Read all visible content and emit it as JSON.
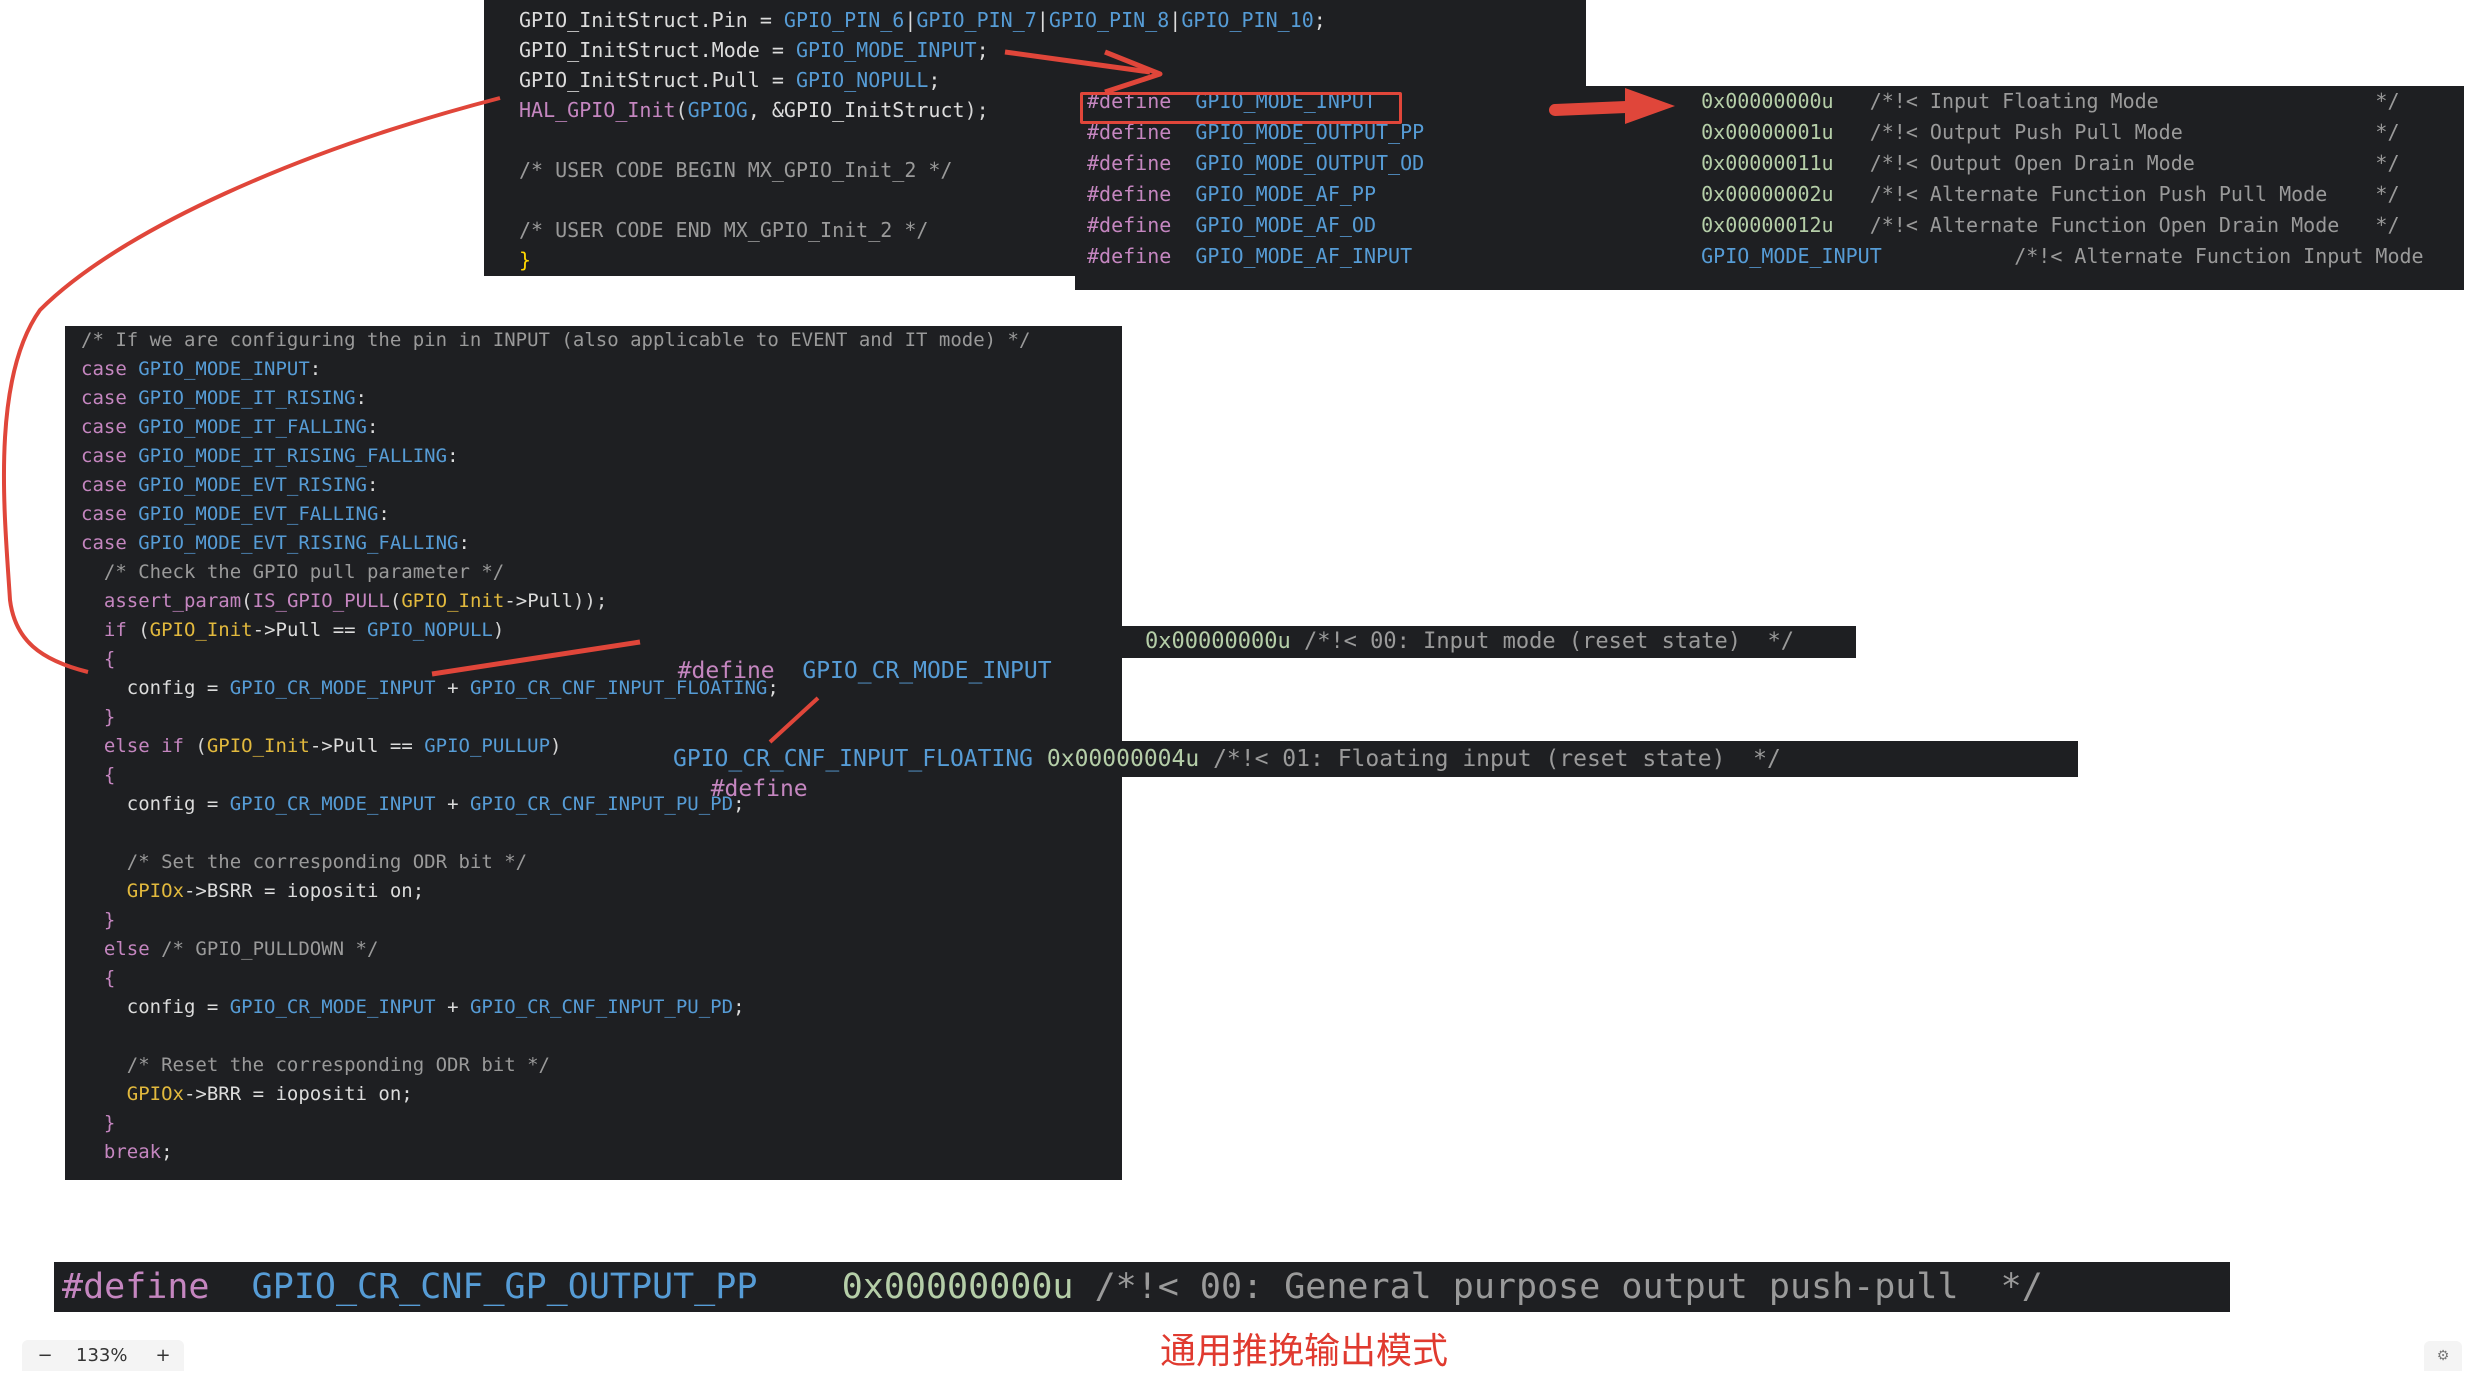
{
  "panels": {
    "init_snippet": [
      [
        [
          "GPIO_InitStruct.Pin = ",
          "plain"
        ],
        [
          "GPIO_PIN_6",
          "blue"
        ],
        [
          "|",
          "plain"
        ],
        [
          "GPIO_PIN_7",
          "blue"
        ],
        [
          "|",
          "plain"
        ],
        [
          "GPIO_PIN_8",
          "blue"
        ],
        [
          "|",
          "plain"
        ],
        [
          "GPIO_PIN_10",
          "blue"
        ],
        [
          ";",
          "plain"
        ]
      ],
      [
        [
          "GPIO_InitStruct.Mode = ",
          "plain"
        ],
        [
          "GPIO_MODE_INPUT",
          "blue"
        ],
        [
          ";",
          "plain"
        ]
      ],
      [
        [
          "GPIO_InitStruct.Pull = ",
          "plain"
        ],
        [
          "GPIO_NOPULL",
          "blue"
        ],
        [
          ";",
          "plain"
        ]
      ],
      [
        [
          "HAL_GPIO_Init",
          "pink"
        ],
        [
          "(",
          "punc"
        ],
        [
          "GPIOG",
          "blue"
        ],
        [
          ", &GPIO_InitStruct",
          "plain"
        ],
        [
          ");",
          "punc"
        ]
      ],
      [],
      [
        [
          "/* USER CODE BEGIN MX_GPIO_Init_2 */",
          "comment"
        ]
      ],
      [],
      [
        [
          "/* USER CODE END MX_GPIO_Init_2 */",
          "comment"
        ]
      ],
      [
        [
          "}",
          "yellow"
        ]
      ]
    ],
    "mode_defines": [
      [
        [
          "#define",
          "pink"
        ],
        [
          "  ",
          "plain"
        ],
        [
          "GPIO_MODE_INPUT",
          "blue"
        ],
        [
          "                           ",
          "plain"
        ],
        [
          "0x00000000u",
          "num"
        ],
        [
          "   /*!< Input Floating Mode                  */",
          "comment"
        ]
      ],
      [
        [
          "#define",
          "pink"
        ],
        [
          "  ",
          "plain"
        ],
        [
          "GPIO_MODE_OUTPUT_PP",
          "blue"
        ],
        [
          "                       ",
          "plain"
        ],
        [
          "0x00000001u",
          "num"
        ],
        [
          "   /*!< Output Push Pull Mode                */",
          "comment"
        ]
      ],
      [
        [
          "#define",
          "pink"
        ],
        [
          "  ",
          "plain"
        ],
        [
          "GPIO_MODE_OUTPUT_OD",
          "blue"
        ],
        [
          "                       ",
          "plain"
        ],
        [
          "0x00000011u",
          "num"
        ],
        [
          "   /*!< Output Open Drain Mode               */",
          "comment"
        ]
      ],
      [
        [
          "#define",
          "pink"
        ],
        [
          "  ",
          "plain"
        ],
        [
          "GPIO_MODE_AF_PP",
          "blue"
        ],
        [
          "                           ",
          "plain"
        ],
        [
          "0x00000002u",
          "num"
        ],
        [
          "   /*!< Alternate Function Push Pull Mode    */",
          "comment"
        ]
      ],
      [
        [
          "#define",
          "pink"
        ],
        [
          "  ",
          "plain"
        ],
        [
          "GPIO_MODE_AF_OD",
          "blue"
        ],
        [
          "                           ",
          "plain"
        ],
        [
          "0x00000012u",
          "num"
        ],
        [
          "   /*!< Alternate Function Open Drain Mode   */",
          "comment"
        ]
      ],
      [
        [
          "#define",
          "pink"
        ],
        [
          "  ",
          "plain"
        ],
        [
          "GPIO_MODE_AF_INPUT",
          "blue"
        ],
        [
          "                        ",
          "plain"
        ],
        [
          "GPIO_MODE_INPUT",
          "blue"
        ],
        [
          "           /*!< Alternate Function Input Mode",
          "comment"
        ]
      ]
    ],
    "switch_case": [
      [
        [
          "/* If we are configuring the pin in INPUT (also applicable to EVENT and IT mode) */",
          "comment"
        ]
      ],
      [
        [
          "case ",
          "pink"
        ],
        [
          "GPIO_MODE_INPUT",
          "blue"
        ],
        [
          ":",
          "plain"
        ]
      ],
      [
        [
          "case ",
          "pink"
        ],
        [
          "GPIO_MODE_IT_RISING",
          "blue"
        ],
        [
          ":",
          "plain"
        ]
      ],
      [
        [
          "case ",
          "pink"
        ],
        [
          "GPIO_MODE_IT_FALLING",
          "blue"
        ],
        [
          ":",
          "plain"
        ]
      ],
      [
        [
          "case ",
          "pink"
        ],
        [
          "GPIO_MODE_IT_RISING_FALLING",
          "blue"
        ],
        [
          ":",
          "plain"
        ]
      ],
      [
        [
          "case ",
          "pink"
        ],
        [
          "GPIO_MODE_EVT_RISING",
          "blue"
        ],
        [
          ":",
          "plain"
        ]
      ],
      [
        [
          "case ",
          "pink"
        ],
        [
          "GPIO_MODE_EVT_FALLING",
          "blue"
        ],
        [
          ":",
          "plain"
        ]
      ],
      [
        [
          "case ",
          "pink"
        ],
        [
          "GPIO_MODE_EVT_RISING_FALLING",
          "blue"
        ],
        [
          ":",
          "plain"
        ]
      ],
      [
        [
          "  /* Check the GPIO pull parameter */",
          "comment"
        ]
      ],
      [
        [
          "  ",
          "plain"
        ],
        [
          "assert_param",
          "pink"
        ],
        [
          "(",
          "punc"
        ],
        [
          "IS_GPIO_PULL",
          "pink"
        ],
        [
          "(",
          "punc"
        ],
        [
          "GPIO_Init",
          "gold"
        ],
        [
          "->Pull",
          "plain"
        ],
        [
          "));",
          "punc"
        ]
      ],
      [
        [
          "  ",
          "plain"
        ],
        [
          "if ",
          "pink"
        ],
        [
          "(",
          "punc"
        ],
        [
          "GPIO_Init",
          "gold"
        ],
        [
          "->Pull == ",
          "plain"
        ],
        [
          "GPIO_NOPULL",
          "blue"
        ],
        [
          ")",
          "punc"
        ]
      ],
      [
        [
          "  ",
          "plain"
        ],
        [
          "{",
          "pink"
        ]
      ],
      [
        [
          "    config = ",
          "plain"
        ],
        [
          "GPIO_CR_MODE_INPUT",
          "blue"
        ],
        [
          " + ",
          "plain"
        ],
        [
          "GPIO_CR_CNF_INPUT_FLOATING",
          "blue"
        ],
        [
          ";",
          "plain"
        ]
      ],
      [
        [
          "  ",
          "plain"
        ],
        [
          "}",
          "pink"
        ]
      ],
      [
        [
          "  ",
          "plain"
        ],
        [
          "else if ",
          "pink"
        ],
        [
          "(",
          "punc"
        ],
        [
          "GPIO_Init",
          "gold"
        ],
        [
          "->Pull == ",
          "plain"
        ],
        [
          "GPIO_PULLUP",
          "blue"
        ],
        [
          ")",
          "punc"
        ]
      ],
      [
        [
          "  ",
          "plain"
        ],
        [
          "{",
          "pink"
        ]
      ],
      [
        [
          "    config = ",
          "plain"
        ],
        [
          "GPIO_CR_MODE_INPUT",
          "blue"
        ],
        [
          " + ",
          "plain"
        ],
        [
          "GPIO_CR_CNF_INPUT_PU_PD",
          "blue"
        ],
        [
          ";",
          "plain"
        ]
      ],
      [],
      [
        [
          "    /* Set the corresponding ODR bit */",
          "comment"
        ]
      ],
      [
        [
          "    ",
          "plain"
        ],
        [
          "GPIOx",
          "gold"
        ],
        [
          "->BSRR = iopositi on;",
          "plain"
        ]
      ],
      [
        [
          "  ",
          "plain"
        ],
        [
          "}",
          "pink"
        ]
      ],
      [
        [
          "  ",
          "plain"
        ],
        [
          "else ",
          "pink"
        ],
        [
          "/* GPIO_PULLDOWN */",
          "comment"
        ]
      ],
      [
        [
          "  ",
          "plain"
        ],
        [
          "{",
          "pink"
        ]
      ],
      [
        [
          "    config = ",
          "plain"
        ],
        [
          "GPIO_CR_MODE_INPUT",
          "blue"
        ],
        [
          " + ",
          "plain"
        ],
        [
          "GPIO_CR_CNF_INPUT_PU_PD",
          "blue"
        ],
        [
          ";",
          "plain"
        ]
      ],
      [],
      [
        [
          "    /* Reset the corresponding ODR bit */",
          "comment"
        ]
      ],
      [
        [
          "    ",
          "plain"
        ],
        [
          "GPIOx",
          "gold"
        ],
        [
          "->BRR = iopositi on;",
          "plain"
        ]
      ],
      [
        [
          "  ",
          "plain"
        ],
        [
          "}",
          "pink"
        ]
      ],
      [
        [
          "  ",
          "plain"
        ],
        [
          "break",
          "pink"
        ],
        [
          ";",
          "plain"
        ]
      ]
    ],
    "cr_mode_input": [
      [
        [
          "0x00000000u",
          "num"
        ],
        [
          " /*!< 00: Input mode (reset state)  */",
          "comment"
        ]
      ]
    ],
    "cr_cnf_floating": [
      [
        [
          "GPIO_CR_CNF_INPUT_FLOATING",
          "blue"
        ],
        [
          " ",
          "plain"
        ],
        [
          "0x00000004u",
          "num"
        ],
        [
          " /*!< 01: Floating input (reset state)  */",
          "comment"
        ]
      ]
    ],
    "cr_cnf_gp_output_pp": [
      [
        [
          "#define",
          "pink"
        ],
        [
          "  ",
          "plain"
        ],
        [
          "GPIO_CR_CNF_GP_OUTPUT_PP",
          "blue"
        ],
        [
          "    ",
          "plain"
        ],
        [
          "0x00000000u",
          "num"
        ],
        [
          " /*!< 00: General purpose output push-pull  */",
          "comment"
        ]
      ]
    ]
  },
  "labels": {
    "define_mode_input_kw": "#define",
    "define_mode_input_name": "GPIO_CR_MODE_INPUT",
    "define_floating_kw": "#define"
  },
  "caption": "通用推挽输出模式",
  "zoom": {
    "minus": "−",
    "level": "133%",
    "plus": "+"
  },
  "corner_icon": "⚙",
  "colors": {
    "editor_bg": "#1e1f22",
    "annotation_red": "#e0463a",
    "keyword": "#c586c0",
    "identifier": "#569cd6",
    "number": "#b5cea8",
    "comment": "#9a9a9a"
  }
}
